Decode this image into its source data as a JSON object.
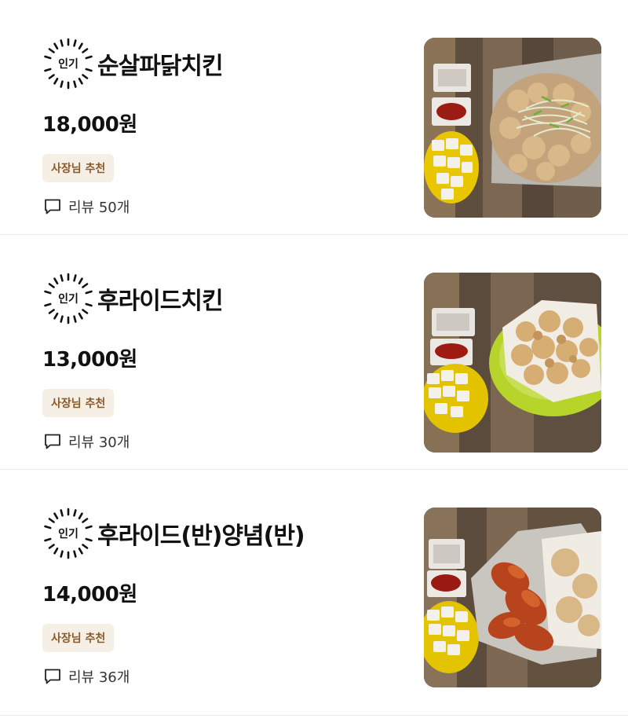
{
  "menu": {
    "items": [
      {
        "badge_label": "인기",
        "name": "순살파닭치킨",
        "price": "18,000원",
        "tag": "사장님 추천",
        "review": "리뷰 50개",
        "image_icon": "chicken-photo"
      },
      {
        "badge_label": "인기",
        "name": "후라이드치킨",
        "price": "13,000원",
        "tag": "사장님 추천",
        "review": "리뷰 30개",
        "image_icon": "chicken-photo"
      },
      {
        "badge_label": "인기",
        "name": "후라이드(반)양념(반)",
        "price": "14,000원",
        "tag": "사장님 추천",
        "review": "리뷰 36개",
        "image_icon": "chicken-photo"
      }
    ]
  },
  "icons": {
    "badge": "popular-badge-icon",
    "review": "speech-bubble-icon"
  },
  "colors": {
    "tag_bg": "#f6efe6",
    "tag_text": "#8a5a2b",
    "divider": "#ececec"
  }
}
